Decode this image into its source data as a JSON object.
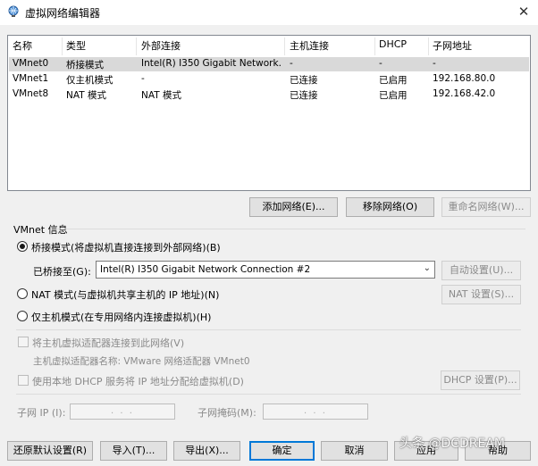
{
  "window": {
    "title": "虚拟网络编辑器",
    "close_glyph": "✕"
  },
  "table": {
    "headers": [
      "名称",
      "类型",
      "外部连接",
      "主机连接",
      "DHCP",
      "子网地址"
    ],
    "rows": [
      [
        "VMnet0",
        "桥接模式",
        "Intel(R) I350 Gigabit Network...",
        "-",
        "-",
        "-"
      ],
      [
        "VMnet1",
        "仅主机模式",
        "-",
        "已连接",
        "已启用",
        "192.168.80.0"
      ],
      [
        "VMnet8",
        "NAT 模式",
        "NAT 模式",
        "已连接",
        "已启用",
        "192.168.42.0"
      ]
    ],
    "selected_row": 0
  },
  "list_buttons": {
    "add": "添加网络(E)...",
    "remove": "移除网络(O)",
    "rename": "重命名网络(W)..."
  },
  "vmnet_info": {
    "label": "VMnet 信息",
    "bridged_label": "桥接模式(将虚拟机直接连接到外部网络)(B)",
    "bridged_to_label": "已桥接至(G):",
    "bridged_to_value": "Intel(R) I350 Gigabit Network Connection #2",
    "auto_settings": "自动设置(U)...",
    "nat_label": "NAT 模式(与虚拟机共享主机的 IP 地址)(N)",
    "nat_settings": "NAT 设置(S)...",
    "hostonly_label": "仅主机模式(在专用网络内连接虚拟机)(H)",
    "connect_adapter_label": "将主机虚拟适配器连接到此网络(V)",
    "adapter_name_label": "主机虚拟适配器名称: VMware 网络适配器 VMnet0",
    "dhcp_label": "使用本地 DHCP 服务将 IP 地址分配给虚拟机(D)",
    "dhcp_settings": "DHCP 设置(P)...",
    "subnet_ip_label": "子网 IP (I):",
    "subnet_mask_label": "子网掩码(M):",
    "ip_placeholder": ".   .   ."
  },
  "footer": {
    "restore": "还原默认设置(R)",
    "import": "导入(T)...",
    "export": "导出(X)...",
    "ok": "确定",
    "cancel": "取消",
    "apply": "应用",
    "help": "帮助"
  },
  "watermark": "头条 @DCDREAM"
}
